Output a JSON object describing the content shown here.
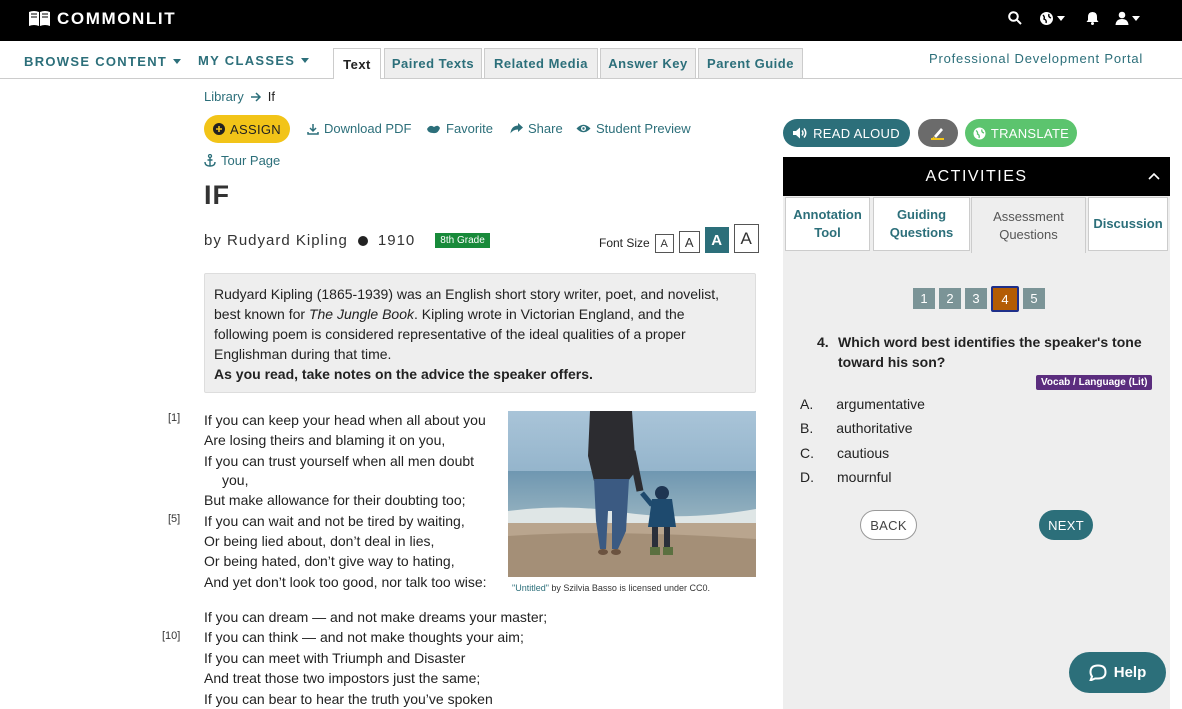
{
  "brand": {
    "name": "COMMONLIT",
    "logo_icon": "open-book-icon"
  },
  "topbar": {
    "search_icon": "search-icon",
    "language_icon": "globe-icon",
    "notifications_icon": "bell-icon",
    "user_icon": "user-icon"
  },
  "subnav": {
    "browse": "BROWSE CONTENT",
    "classes": "MY CLASSES",
    "tabs": [
      "Text",
      "Paired Texts",
      "Related Media",
      "Answer Key",
      "Parent Guide"
    ],
    "active_tab": "Text",
    "portal": "Professional Development Portal"
  },
  "breadcrumb": {
    "library": "Library",
    "current": "If"
  },
  "actions": {
    "assign": "ASSIGN",
    "download": "Download PDF",
    "favorite": "Favorite",
    "share": "Share",
    "preview": "Student Preview",
    "tour": "Tour Page"
  },
  "text": {
    "title": "IF",
    "author": "by Rudyard Kipling",
    "year": "1910",
    "grade": "8th Grade",
    "font_size_label": "Font Size",
    "font_sizes": [
      "A",
      "A",
      "A",
      "A"
    ],
    "intro_1a": "Rudyard Kipling (1865-1939) was an English short story writer, poet, and novelist,",
    "intro_1b": "best known for ",
    "intro_book": "The Jungle Book",
    "intro_1c": ". Kipling wrote in Victorian England, and the",
    "intro_2": "following poem is considered representative of the ideal qualities of a proper",
    "intro_3": "Englishman during that time.",
    "intro_bold": "As you read, take notes on the advice the speaker offers.",
    "stanza1": [
      "If you can keep your head when all about you",
      "Are losing theirs and blaming it on you,",
      "If you can trust yourself when all men doubt",
      "you,",
      "But make allowance for their doubting too;",
      "If you can wait and not be tired by waiting,",
      "Or being lied about, don’t deal in lies,",
      "Or being hated, don’t give way to hating,",
      "And yet don’t look too good, nor talk too wise:"
    ],
    "stanza2": [
      "If you can dream — and not make dreams your master;",
      "If you can think — and not make thoughts your aim;",
      "If you can meet with Triumph and Disaster",
      "And treat those two impostors just the same;",
      "If you can bear to hear the truth you’ve spoken"
    ],
    "line_numbers": [
      "[1]",
      "[5]",
      "[10]"
    ],
    "caption_link": "\"Untitled\"",
    "caption_rest": " by Szilvia Basso is licensed under CC0."
  },
  "tools": {
    "read_aloud": "READ ALOUD",
    "translate": "TRANSLATE",
    "highlighter_icon": "highlighter-icon"
  },
  "activities": {
    "header": "ACTIVITIES",
    "tabs": [
      "Annotation Tool",
      "Guiding Questions",
      "Assessment Questions",
      "Discussion"
    ],
    "active_tab": "Assessment Questions",
    "question_numbers": [
      "1",
      "2",
      "3",
      "4",
      "5"
    ],
    "current_question": "4",
    "question_number": "4.",
    "question_text": "Which word best identifies the speaker's tone toward his son?",
    "standard": "Vocab / Language (Lit)",
    "choices": [
      {
        "letter": "A.",
        "text": "argumentative"
      },
      {
        "letter": "B.",
        "text": "authoritative"
      },
      {
        "letter": "C.",
        "text": "cautious"
      },
      {
        "letter": "D.",
        "text": "mournful"
      }
    ],
    "back": "BACK",
    "next": "NEXT"
  },
  "help": "Help",
  "colors": {
    "teal": "#2c6f7a",
    "green": "#5cc46e",
    "assign_yellow": "#f2c418",
    "current_q": "#b35c04",
    "vocab": "#5b2d7e"
  }
}
